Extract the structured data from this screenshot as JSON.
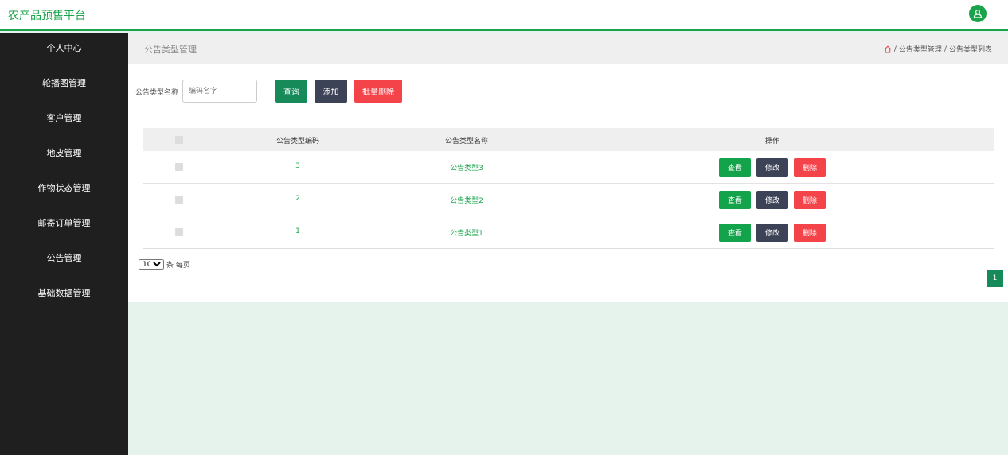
{
  "app": {
    "title": "农产品预售平台"
  },
  "sidebar": {
    "items": [
      {
        "label": "个人中心"
      },
      {
        "label": "轮播图管理"
      },
      {
        "label": "客户管理"
      },
      {
        "label": "地皮管理"
      },
      {
        "label": "作物状态管理"
      },
      {
        "label": "邮寄订单管理"
      },
      {
        "label": "公告管理"
      },
      {
        "label": "基础数据管理"
      }
    ]
  },
  "page": {
    "title": "公告类型管理",
    "breadcrumb": [
      "公告类型管理",
      "公告类型列表"
    ],
    "breadcrumb_sep": "/"
  },
  "search": {
    "label": "公告类型名称",
    "placeholder": "编码名字",
    "query_label": "查询",
    "add_label": "添加",
    "batch_delete_label": "批量删除"
  },
  "table": {
    "headers": {
      "code": "公告类型编码",
      "name": "公告类型名称",
      "ops": "操作"
    },
    "rows": [
      {
        "code": "3",
        "name": "公告类型3"
      },
      {
        "code": "2",
        "name": "公告类型2"
      },
      {
        "code": "1",
        "name": "公告类型1"
      }
    ],
    "actions": {
      "view": "查看",
      "edit": "修改",
      "delete": "删除"
    }
  },
  "pagination": {
    "page_size": "10",
    "page_size_suffix": "条 每页",
    "current_page": "1"
  },
  "colors": {
    "brand": "#1aa34a",
    "sidebar_bg": "#1f1f1f",
    "danger": "#f5434a",
    "dark_button": "#3d4356"
  }
}
